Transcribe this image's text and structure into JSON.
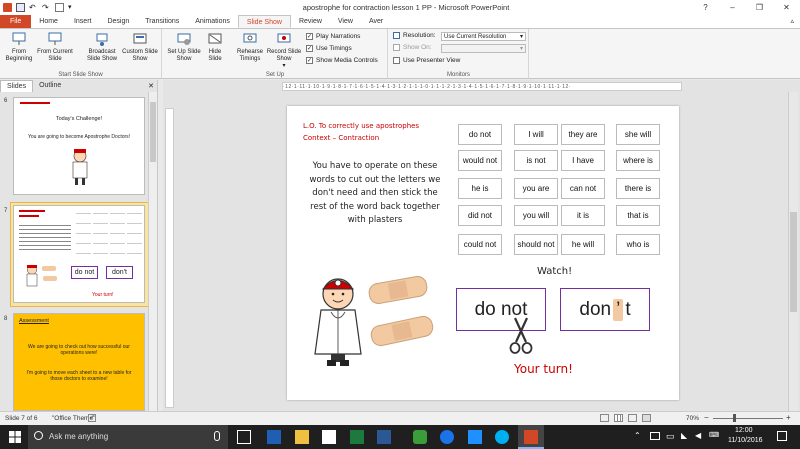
{
  "window": {
    "title": "apostrophe for contraction lesson 1 PP - Microsoft PowerPoint",
    "minimize": "–",
    "maximize": "❐",
    "close": "✕",
    "help": "?"
  },
  "ribbon_tabs": [
    "File",
    "Home",
    "Insert",
    "Design",
    "Transitions",
    "Animations",
    "Slide Show",
    "Review",
    "View",
    "Aver"
  ],
  "active_tab": "Slide Show",
  "ribbon": {
    "groups": [
      {
        "label": "Start Slide Show",
        "buttons": [
          "From Beginning",
          "From Current Slide",
          "Broadcast Slide Show",
          "Custom Slide Show"
        ]
      },
      {
        "label": "Set Up",
        "buttons": [
          "Set Up Slide Show",
          "Hide Slide",
          "Rehearse Timings",
          "Record Slide Show"
        ]
      },
      {
        "label": "Monitors"
      }
    ],
    "checkboxes": [
      {
        "label": "Play Narrations",
        "checked": true
      },
      {
        "label": "Use Timings",
        "checked": true
      },
      {
        "label": "Show Media Controls",
        "checked": true
      }
    ],
    "resolution_label": "Resolution:",
    "resolution_value": "Use Current Resolution",
    "show_on_label": "Show On:",
    "show_on_value": "",
    "presenter_view_label": "Use Presenter View"
  },
  "left_pane": {
    "tabs": [
      "Slides",
      "Outline"
    ],
    "slides": [
      {
        "number": "6",
        "title": "Today's Challenge!",
        "body": "You are going to become Apostrophe Doctors!"
      },
      {
        "number": "7",
        "selected": true,
        "text": "do not",
        "contracted": "don't",
        "sub": "Your turn!"
      },
      {
        "number": "8",
        "heading": "Assessment",
        "body1": "We are going to check out how successful our operations were!",
        "body2": "I'm going to move each sheet to a new table for those doctors to examine!"
      }
    ]
  },
  "ruler_top": "·12·1·11·1·10·1·9·1·8·1·7·1·6·1·5·1·4·1·3·1·2·1·1·1·0·1·1·1·2·1·3·1·4·1·5·1·6·1·7·1·8·1·9·1·10·1·11·1·12·",
  "slide": {
    "lo_line1": "L.O. To correctly use apostrophes",
    "lo_line2": "Context – Contraction",
    "instructions": "You have to operate on these words to cut out the letters we don't need and then stick the rest of the word back together with plasters",
    "words": [
      [
        "do not",
        "I will",
        "they are",
        "she will"
      ],
      [
        "would not",
        "is not",
        "I have",
        "where is"
      ],
      [
        "he is",
        "you are",
        "can not",
        "there is"
      ],
      [
        "did not",
        "you will",
        "it is",
        "that is"
      ],
      [
        "could not",
        "should not",
        "he will",
        "who is"
      ]
    ],
    "watch": "Watch!",
    "example_full": "do not",
    "example_contracted_a": "don",
    "example_contracted_apostrophe": "’",
    "example_contracted_b": "t",
    "your_turn": "Your turn!"
  },
  "statusbar": {
    "slide_info": "Slide 7 of 6",
    "theme": "\"Office Theme\"",
    "zoom": "70%"
  },
  "taskbar": {
    "search_placeholder": "Ask me anything",
    "time": "12:00",
    "date": "11/10/2016"
  },
  "colors": {
    "file_tab": "#d24726",
    "active_tab_text": "#d24726",
    "assessment_slide_bg": "#ffc000",
    "red_text": "#c00000",
    "example_box_border": "#7030a0",
    "plaster": "#f2c9a0"
  }
}
